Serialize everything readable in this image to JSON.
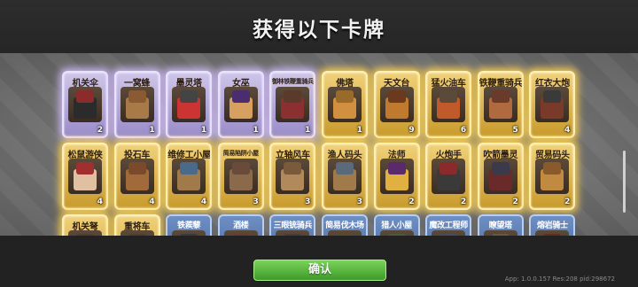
{
  "title": "获得以下卡牌",
  "confirm_label": "确认",
  "footer": "App: 1.0.0.157 Res:208 pid:298672",
  "colors": {
    "purple_frame": "#cfc6ea",
    "gold_frame": "#f1d27a",
    "blue_frame": "#6e8fc4",
    "confirm_green": "#5bbf40"
  },
  "rows": [
    [
      {
        "name": "机关伞",
        "count": "2",
        "rarity": "purple",
        "art": [
          "#8b2b2b",
          "#2b2b2b"
        ]
      },
      {
        "name": "一窝蜂",
        "count": "1",
        "rarity": "purple",
        "art": [
          "#8a5a32",
          "#a87a48"
        ]
      },
      {
        "name": "墨灵塔",
        "count": "1",
        "rarity": "purple",
        "art": [
          "#444",
          "#c33"
        ]
      },
      {
        "name": "女巫",
        "count": "1",
        "rarity": "purple",
        "art": [
          "#4b2c6e",
          "#d8a060"
        ]
      },
      {
        "name": "御林铁鞭重骑兵",
        "count": "1",
        "rarity": "purple",
        "art": [
          "#5a3a2a",
          "#8b3030"
        ],
        "small": true
      },
      {
        "name": "佛塔",
        "count": "1",
        "rarity": "gold",
        "art": [
          "#9a6a2a",
          "#d09040"
        ]
      },
      {
        "name": "天文台",
        "count": "9",
        "rarity": "gold",
        "art": [
          "#6b3a1e",
          "#c07a30"
        ]
      },
      {
        "name": "猛火油车",
        "count": "6",
        "rarity": "gold",
        "art": [
          "#5a4a3a",
          "#c05a2a"
        ]
      },
      {
        "name": "铁鞭重骑兵",
        "count": "5",
        "rarity": "gold",
        "art": [
          "#6a3a2a",
          "#b06a40"
        ]
      },
      {
        "name": "红衣大炮",
        "count": "4",
        "rarity": "gold",
        "art": [
          "#3a3a3a",
          "#7a3a2a"
        ]
      }
    ],
    [
      {
        "name": "松鼠游侠",
        "count": "4",
        "rarity": "gold",
        "art": [
          "#a03030",
          "#e0c0a0"
        ]
      },
      {
        "name": "投石车",
        "count": "4",
        "rarity": "gold",
        "art": [
          "#7a4a2a",
          "#a06a3a"
        ]
      },
      {
        "name": "维修工小屋",
        "count": "4",
        "rarity": "gold",
        "art": [
          "#4a6a8a",
          "#a07a4a"
        ]
      },
      {
        "name": "简易陷阱小屋",
        "count": "3",
        "rarity": "gold",
        "art": [
          "#6a4a3a",
          "#8a6a4a"
        ],
        "small": true
      },
      {
        "name": "立轴风车",
        "count": "3",
        "rarity": "gold",
        "art": [
          "#7a5a3a",
          "#b08a5a"
        ]
      },
      {
        "name": "渔人码头",
        "count": "3",
        "rarity": "gold",
        "art": [
          "#5a6a7a",
          "#a07a4a"
        ]
      },
      {
        "name": "法师",
        "count": "2",
        "rarity": "gold",
        "art": [
          "#5a2a6a",
          "#e0b040"
        ]
      },
      {
        "name": "火炮手",
        "count": "2",
        "rarity": "gold",
        "art": [
          "#8a2a2a",
          "#3a3a3a"
        ]
      },
      {
        "name": "吹箭墨灵",
        "count": "2",
        "rarity": "gold",
        "art": [
          "#3a3a4a",
          "#6a2a2a"
        ]
      },
      {
        "name": "贸易码头",
        "count": "2",
        "rarity": "gold",
        "art": [
          "#8a5a2a",
          "#c08a40"
        ]
      }
    ],
    [
      {
        "name": "机关弩",
        "count": "",
        "rarity": "gold",
        "art": [
          "#5a3a2a",
          "#8a6a4a"
        ]
      },
      {
        "name": "重将车",
        "count": "",
        "rarity": "gold",
        "art": [
          "#5a3a2a",
          "#8a6a4a"
        ]
      },
      {
        "name": "铁蒺藜",
        "count": "",
        "rarity": "blue",
        "art": [
          "#3a3a3a",
          "#6a6a6a"
        ]
      },
      {
        "name": "酒楼",
        "count": "",
        "rarity": "blue",
        "art": [
          "#6a3a2a",
          "#a06a3a"
        ]
      },
      {
        "name": "三眼铳骑兵",
        "count": "",
        "rarity": "blue",
        "art": [
          "#4a3a3a",
          "#8a5a3a"
        ]
      },
      {
        "name": "简易伐木场",
        "count": "",
        "rarity": "blue",
        "art": [
          "#5a4a2a",
          "#8a6a3a"
        ]
      },
      {
        "name": "猎人小屋",
        "count": "",
        "rarity": "blue",
        "art": [
          "#4a5a3a",
          "#8a6a3a"
        ]
      },
      {
        "name": "魔改工程师",
        "count": "",
        "rarity": "blue",
        "art": [
          "#4a4a5a",
          "#a07a3a"
        ]
      },
      {
        "name": "瞭望塔",
        "count": "",
        "rarity": "blue",
        "art": [
          "#6a5a3a",
          "#9a7a4a"
        ]
      },
      {
        "name": "熔岩骑士",
        "count": "",
        "rarity": "blue",
        "art": [
          "#6a2a1a",
          "#c05a2a"
        ]
      }
    ]
  ]
}
